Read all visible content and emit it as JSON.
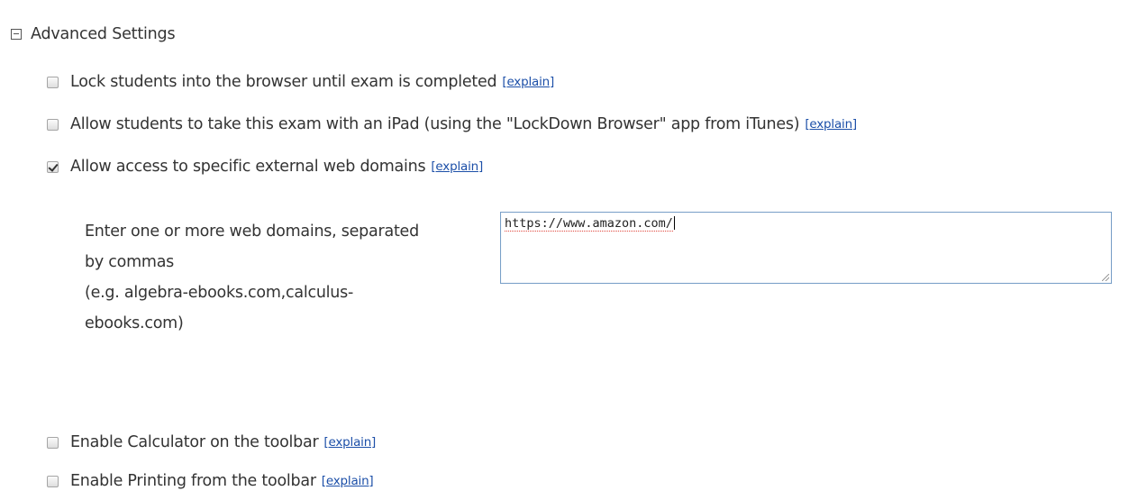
{
  "section": {
    "title": "Advanced Settings",
    "icon": "collapse-minus-icon"
  },
  "options": [
    {
      "label": "Lock students into the browser until exam is completed",
      "explain": "[explain]",
      "checked": false
    },
    {
      "label": "Allow students to take this exam with an iPad (using the \"LockDown Browser\" app from iTunes)",
      "explain": "[explain]",
      "checked": false
    },
    {
      "label": "Allow access to specific external web domains",
      "explain": "[explain]",
      "checked": true
    },
    {
      "label": "Enable Calculator on the toolbar",
      "explain": "[explain]",
      "checked": false
    },
    {
      "label": "Enable Printing from the toolbar",
      "explain": "[explain]",
      "checked": false
    }
  ],
  "domains": {
    "label_lines": [
      "Enter one or more web domains, separated",
      "by commas",
      "(e.g. algebra-ebooks.com,calculus-",
      "ebooks.com)"
    ],
    "value": "https://www.amazon.com/"
  },
  "colors": {
    "link": "#1c4fa8",
    "text": "#333333",
    "input_border": "#7aa0c8"
  }
}
